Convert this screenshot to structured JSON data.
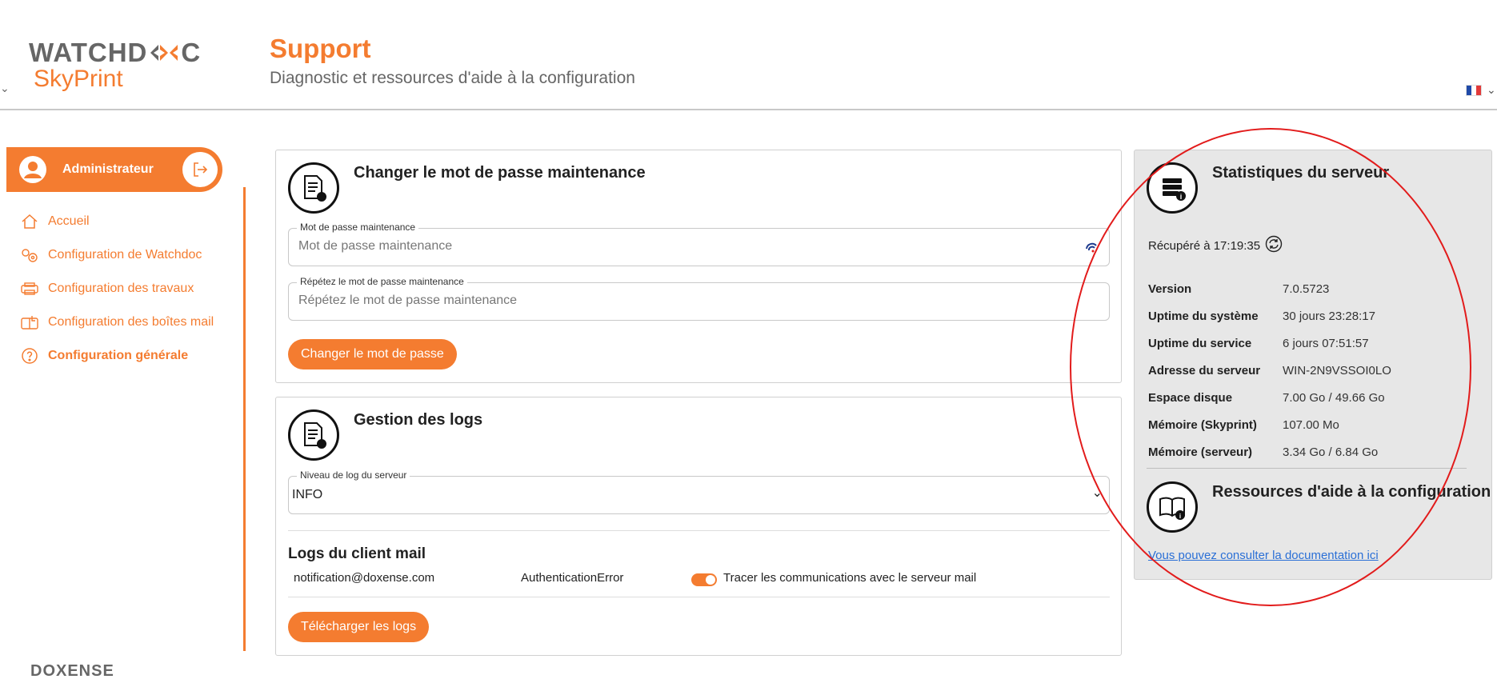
{
  "brand": {
    "logo_top_prefix": "WATCHD",
    "logo_top_suffix": "C",
    "logo_bottom": "SkyPrint",
    "footer": "DOXENSE"
  },
  "header": {
    "title": "Support",
    "subtitle": "Diagnostic et ressources d'aide à la configuration"
  },
  "sidebar": {
    "user": "Administrateur",
    "items": [
      {
        "label": "Accueil"
      },
      {
        "label": "Configuration de Watchdoc"
      },
      {
        "label": "Configuration des travaux"
      },
      {
        "label": "Configuration des boîtes mail"
      },
      {
        "label": "Configuration générale"
      }
    ]
  },
  "password_card": {
    "title": "Changer le mot de passe maintenance",
    "field1_label": "Mot de passe maintenance",
    "field1_placeholder": "Mot de passe maintenance",
    "field2_label": "Répétez le mot de passe maintenance",
    "field2_placeholder": "Répétez le mot de passe maintenance",
    "button": "Changer le mot de passe"
  },
  "logs_card": {
    "title": "Gestion des logs",
    "level_label": "Niveau de log du serveur",
    "level_value": "INFO",
    "mail_logs_title": "Logs du client mail",
    "mail_row": {
      "email": "notification@doxense.com",
      "status": "AuthenticationError",
      "toggle_label": "Tracer les communications avec le serveur mail"
    },
    "button": "Télécharger les logs"
  },
  "stats": {
    "title": "Statistiques du serveur",
    "retrieved": "Récupéré à 17:19:35",
    "rows": [
      {
        "k": "Version",
        "v": "7.0.5723"
      },
      {
        "k": "Uptime du système",
        "v": "30 jours 23:28:17"
      },
      {
        "k": "Uptime du service",
        "v": "6 jours 07:51:57"
      },
      {
        "k": "Adresse du serveur",
        "v": "WIN-2N9VSSOI0LO"
      },
      {
        "k": "Espace disque",
        "v": "7.00 Go / 49.66 Go"
      },
      {
        "k": "Mémoire (Skyprint)",
        "v": "107.00 Mo"
      },
      {
        "k": "Mémoire (serveur)",
        "v": "3.34 Go / 6.84 Go"
      }
    ],
    "resources_title": "Ressources d'aide à la configuration",
    "doc_link": "Vous pouvez consulter la documentation ici"
  },
  "colors": {
    "accent": "#f47c30",
    "annotation": "#e21b1b",
    "link": "#2a6fd6"
  }
}
